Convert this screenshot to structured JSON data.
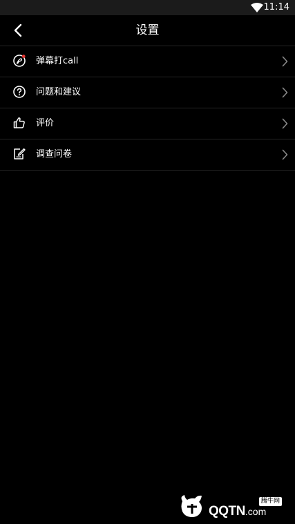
{
  "status_bar": {
    "time": "11:14",
    "wifi_icon": "wifi-icon"
  },
  "app_bar": {
    "title": "设置",
    "back_icon": "chevron-left-icon"
  },
  "settings": {
    "items": [
      {
        "label": "弹幕打call",
        "icon": "call-bubble-icon",
        "badge_color": "#e53935"
      },
      {
        "label": "问题和建议",
        "icon": "question-circle-icon"
      },
      {
        "label": "评价",
        "icon": "thumbs-up-icon"
      },
      {
        "label": "调查问卷",
        "icon": "edit-note-icon"
      }
    ]
  },
  "watermark": {
    "brand": "QQTN",
    "domain": ".com",
    "badge": "腾牛网"
  },
  "colors": {
    "background": "#000000",
    "status_bar": "#1b1b1b",
    "divider": "#262626",
    "text": "#ffffff",
    "chevron": "#8a8a8a",
    "badge": "#e53935"
  }
}
